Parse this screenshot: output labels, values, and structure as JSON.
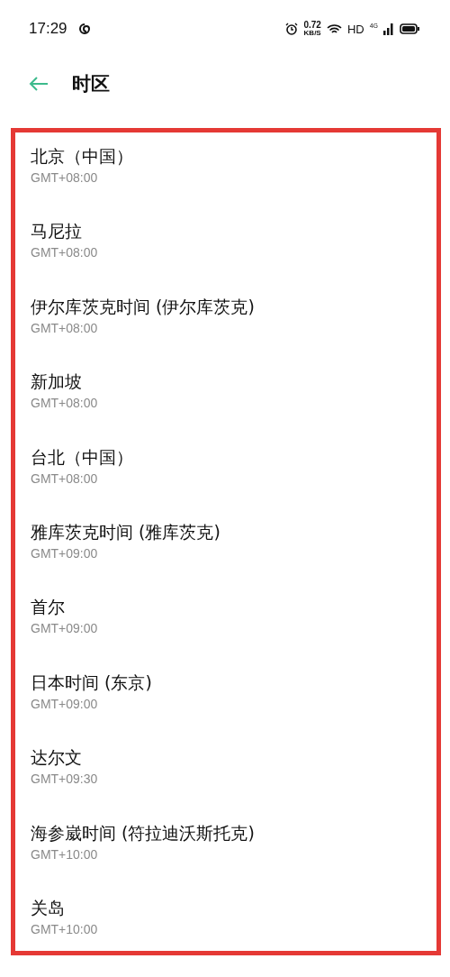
{
  "status_bar": {
    "time": "17:29",
    "speed": "0.72",
    "speed_unit": "KB/S",
    "network": "HD",
    "cellular": "4G"
  },
  "header": {
    "title": "时区"
  },
  "timezones": [
    {
      "name": "北京（中国）",
      "offset": "GMT+08:00"
    },
    {
      "name": "马尼拉",
      "offset": "GMT+08:00"
    },
    {
      "name": "伊尔库茨克时间 (伊尔库茨克)",
      "offset": "GMT+08:00"
    },
    {
      "name": "新加坡",
      "offset": "GMT+08:00"
    },
    {
      "name": "台北（中国）",
      "offset": "GMT+08:00"
    },
    {
      "name": "雅库茨克时间 (雅库茨克)",
      "offset": "GMT+09:00"
    },
    {
      "name": "首尔",
      "offset": "GMT+09:00"
    },
    {
      "name": "日本时间 (东京)",
      "offset": "GMT+09:00"
    },
    {
      "name": "达尔文",
      "offset": "GMT+09:30"
    },
    {
      "name": "海参崴时间 (符拉迪沃斯托克)",
      "offset": "GMT+10:00"
    },
    {
      "name": "关岛",
      "offset": "GMT+10:00"
    }
  ]
}
